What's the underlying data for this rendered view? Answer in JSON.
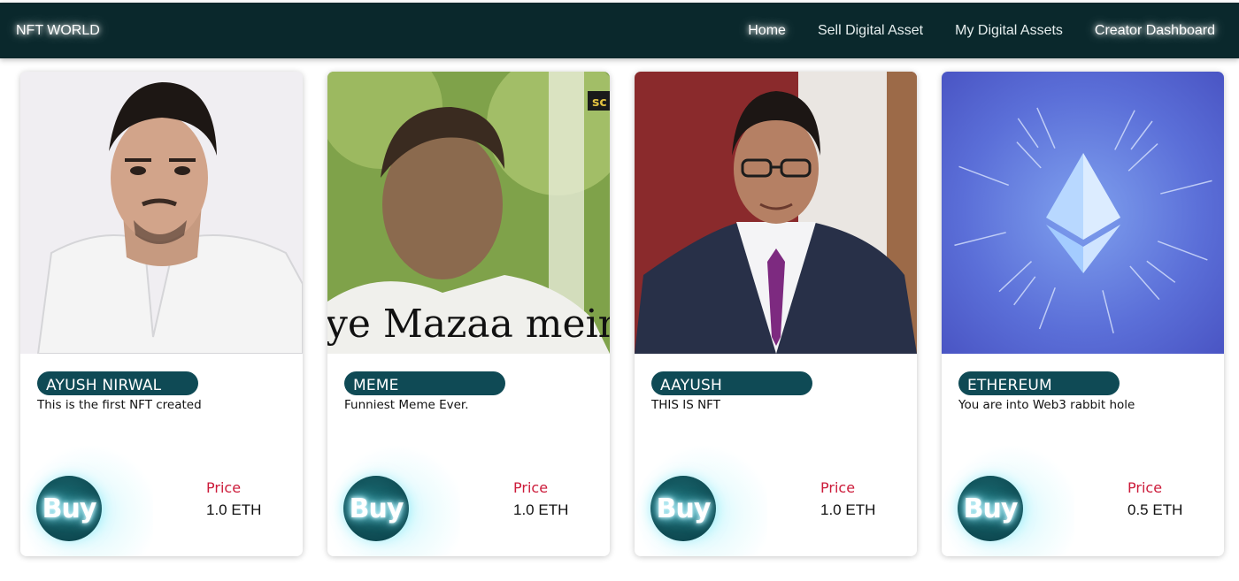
{
  "navbar": {
    "brand": "NFT WORLD",
    "links": [
      {
        "label": "Home"
      },
      {
        "label": "Sell Digital Asset"
      },
      {
        "label": "My Digital Assets"
      },
      {
        "label": "Creator Dashboard"
      }
    ]
  },
  "cards": [
    {
      "name": "AYUSH NIRWAL",
      "description": "This is the first NFT created",
      "buy_label": "Buy",
      "price_label": "Price",
      "price": "1.0 ETH",
      "image": "portrait-photo"
    },
    {
      "name": "MEME",
      "description": "Funniest Meme Ever.",
      "buy_label": "Buy",
      "price_label": "Price",
      "price": "1.0 ETH",
      "image": "meme-screenshot",
      "image_caption": "ye Mazaa mein",
      "image_corner_text": "sc"
    },
    {
      "name": "AAYUSH",
      "description": "THIS IS NFT",
      "buy_label": "Buy",
      "price_label": "Price",
      "price": "1.0 ETH",
      "image": "portrait-photo-suit"
    },
    {
      "name": "ETHEREUM",
      "description": "You are into Web3 rabbit hole",
      "buy_label": "Buy",
      "price_label": "Price",
      "price": "0.5 ETH",
      "image": "ethereum-logo"
    }
  ],
  "colors": {
    "navbar_bg": "#0a282c",
    "pill_bg": "#0f4a55",
    "buy_bg": "#0e4a52",
    "price_label": "#cc1b3a"
  }
}
